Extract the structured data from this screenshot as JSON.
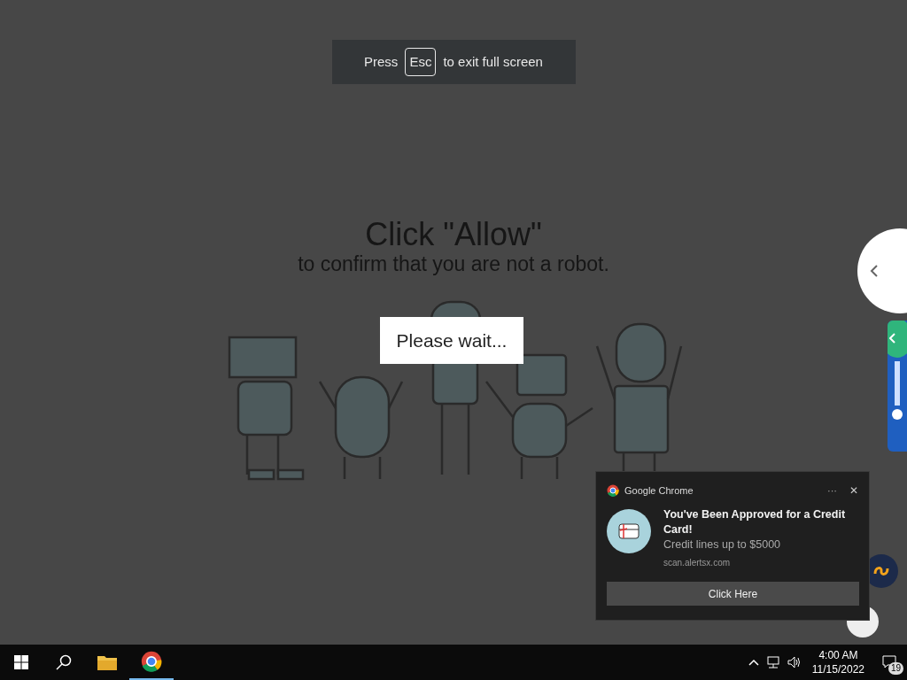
{
  "fullscreen_hint": {
    "before": "Press",
    "key": "Esc",
    "after": "to exit full screen"
  },
  "page": {
    "title": "Click \"Allow\"",
    "subtitle": "to confirm that you are not a robot.",
    "wait": "Please wait..."
  },
  "notification": {
    "app": "Google Chrome",
    "more": "···",
    "close": "✕",
    "title": "You've Been Approved for a Credit Card!",
    "body": "Credit lines up to $5000",
    "source": "scan.alertsx.com",
    "button": "Click Here"
  },
  "taskbar": {
    "time": "4:00 AM",
    "date": "11/15/2022",
    "notifications": "19"
  }
}
